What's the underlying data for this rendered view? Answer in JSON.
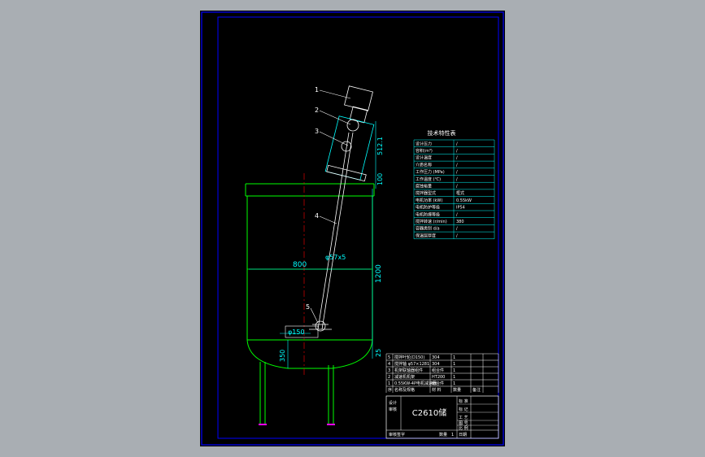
{
  "drawing": {
    "part_numbers": [
      "1",
      "2",
      "3",
      "4",
      "5"
    ],
    "dimensions": {
      "length_512": "512.1",
      "d100": "100",
      "d1200": "1200",
      "d25": "25",
      "d800": "800",
      "d350": "350",
      "dia_shaft": "φ57x5",
      "dia_base": "φ150"
    }
  },
  "tech_table": {
    "title": "技术特性表",
    "rows": [
      {
        "name": "设计压力",
        "value": "/"
      },
      {
        "name": "容积(m³)",
        "value": "/"
      },
      {
        "name": "设计温度",
        "value": "/"
      },
      {
        "name": "介质名称",
        "value": "/"
      },
      {
        "name": "工作压力 (MPa)",
        "value": "/"
      },
      {
        "name": "工作温度 (℃)",
        "value": "/"
      },
      {
        "name": "腐蚀裕量",
        "value": "/"
      },
      {
        "name": "搅拌器型式",
        "value": "框式"
      },
      {
        "name": "电机功率 (kW)",
        "value": "0.55kW"
      },
      {
        "name": "电机防护等级",
        "value": "IP54"
      },
      {
        "name": "电机防爆等级",
        "value": "/"
      },
      {
        "name": "搅拌转速 (r/min)",
        "value": "380"
      },
      {
        "name": "容器类别 d/a",
        "value": "/"
      },
      {
        "name": "保温层厚度",
        "value": "/"
      }
    ]
  },
  "parts_list": {
    "rows": [
      {
        "no": "5",
        "name": "搅拌叶轮(D150)",
        "material": "304",
        "qty": "1"
      },
      {
        "no": "4",
        "name": "搅拌轴 φ57×1281",
        "material": "304",
        "qty": "1"
      },
      {
        "no": "3",
        "name": "机架联轴器组件",
        "material": "组合件",
        "qty": "1"
      },
      {
        "no": "2",
        "name": "减速机机架",
        "material": "HT200",
        "qty": "1"
      },
      {
        "no": "1",
        "name": "0.55KW-4P电机减速器",
        "material": "组合件",
        "qty": "1"
      }
    ],
    "header": {
      "no": "序",
      "name": "名称及规格",
      "material": "材 料",
      "qty": "数量",
      "remark": "备注"
    }
  },
  "title_block": {
    "drawing_title": "C2610储",
    "left_labels": [
      "设计",
      "审核"
    ],
    "right_labels": [
      "标 准",
      "标 记",
      "工 艺",
      "图 号",
      "比 例"
    ],
    "bottom_left": "审核签字",
    "sheet_label": "数量",
    "sheet_value": "1",
    "date_label": "日期"
  },
  "colors": {
    "vessel": "#00ff00",
    "dimension": "#00ffff",
    "frame": "#0000ff",
    "equipment": "#ffffff",
    "hatch": "#ff00ff",
    "sheet_bg": "#000000",
    "viewport_bg": "#a9aeb3"
  }
}
